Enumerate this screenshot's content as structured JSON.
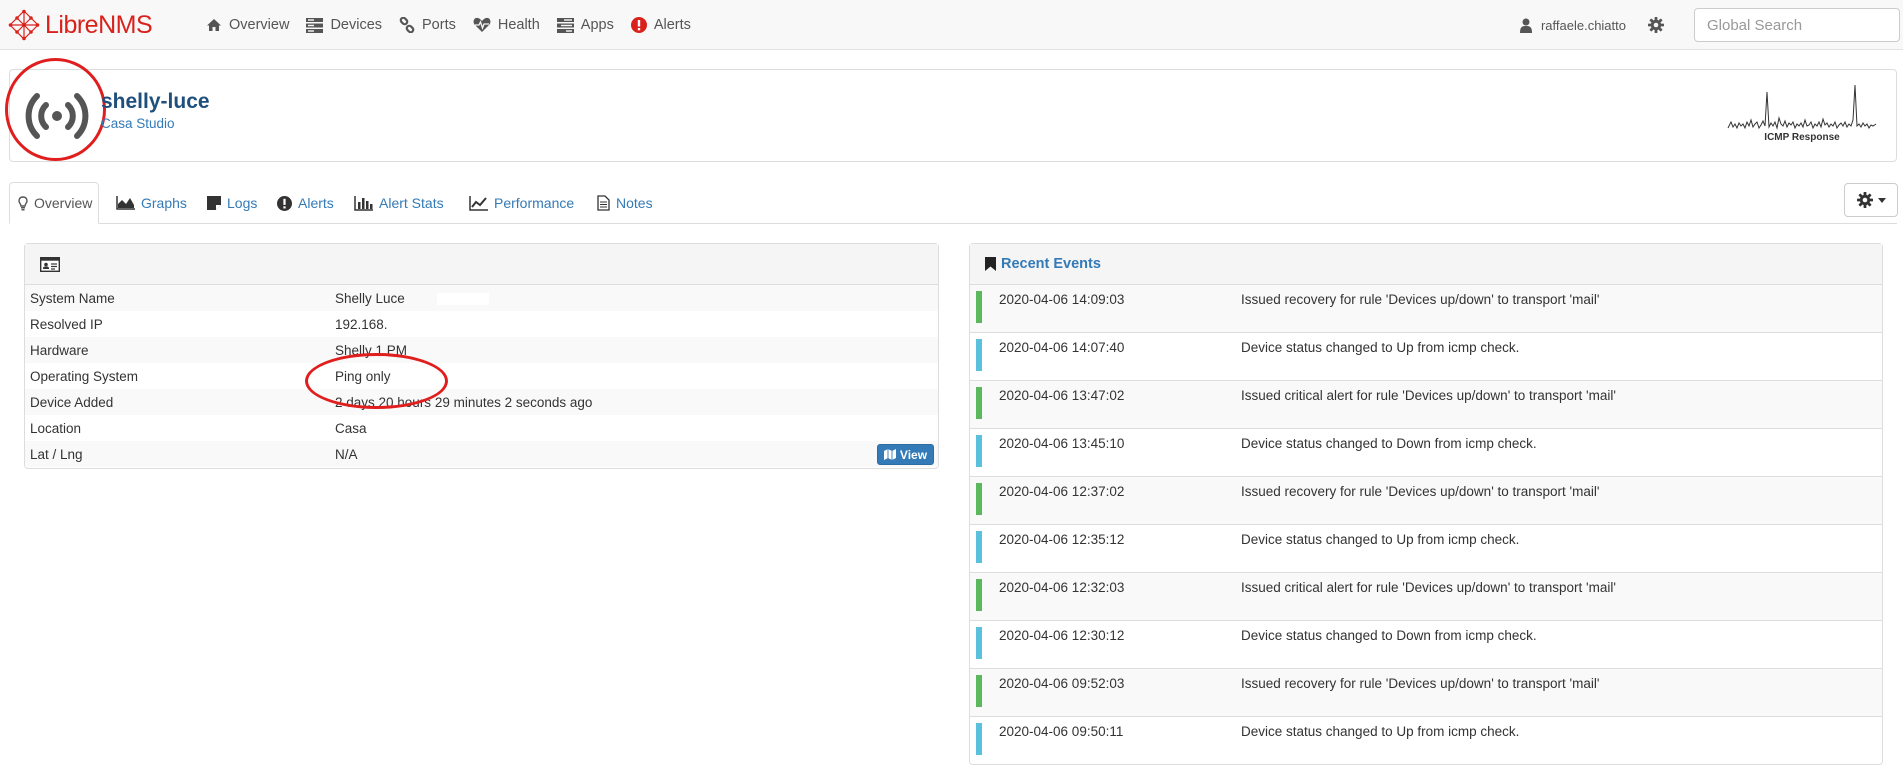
{
  "navbar": {
    "brand_libre": "Libre",
    "brand_nms": "NMS",
    "items": [
      {
        "label": "Overview",
        "icon": "home-icon"
      },
      {
        "label": "Devices",
        "icon": "server-icon"
      },
      {
        "label": "Ports",
        "icon": "link-icon"
      },
      {
        "label": "Health",
        "icon": "heartbeat-icon"
      },
      {
        "label": "Apps",
        "icon": "tasks-icon"
      },
      {
        "label": "Alerts",
        "icon": "exclamation-circle-icon"
      }
    ],
    "user": "raffaele.chiatto",
    "search_placeholder": "Global Search"
  },
  "device": {
    "name": "shelly-luce",
    "location": "Casa Studio",
    "sparkline_label": "ICMP Response"
  },
  "tabs": [
    {
      "label": "Overview",
      "icon": "lightbulb-icon",
      "active": true
    },
    {
      "label": "Graphs",
      "icon": "area-chart-icon"
    },
    {
      "label": "Logs",
      "icon": "sticky-note-icon"
    },
    {
      "label": "Alerts",
      "icon": "exclamation-circle-icon"
    },
    {
      "label": "Alert Stats",
      "icon": "bar-chart-icon"
    },
    {
      "label": "Performance",
      "icon": "line-chart-icon"
    },
    {
      "label": "Notes",
      "icon": "file-text-icon"
    }
  ],
  "overview": {
    "rows": [
      {
        "label": "System Name",
        "value": "Shelly Luce"
      },
      {
        "label": "Resolved IP",
        "value": "192.168."
      },
      {
        "label": "Hardware",
        "value": "Shelly 1 PM"
      },
      {
        "label": "Operating System",
        "value": "Ping only"
      },
      {
        "label": "Device Added",
        "value": "2 days 20 hours 29 minutes 2 seconds ago"
      },
      {
        "label": "Location",
        "value": "Casa"
      },
      {
        "label": "Lat / Lng",
        "value": "N/A"
      }
    ],
    "view_button": "View"
  },
  "events": {
    "title": "Recent Events",
    "colors": {
      "ok": "#5cb85c",
      "info": "#5bc0de"
    },
    "rows": [
      {
        "time": "2020-04-06 14:09:03",
        "message": "Issued recovery for rule 'Devices up/down' to transport 'mail'",
        "type": "ok"
      },
      {
        "time": "2020-04-06 14:07:40",
        "message": "Device status changed to Up from icmp check.",
        "type": "info"
      },
      {
        "time": "2020-04-06 13:47:02",
        "message": "Issued critical alert for rule 'Devices up/down' to transport 'mail'",
        "type": "ok"
      },
      {
        "time": "2020-04-06 13:45:10",
        "message": "Device status changed to Down from icmp check.",
        "type": "info"
      },
      {
        "time": "2020-04-06 12:37:02",
        "message": "Issued recovery for rule 'Devices up/down' to transport 'mail'",
        "type": "ok"
      },
      {
        "time": "2020-04-06 12:35:12",
        "message": "Device status changed to Up from icmp check.",
        "type": "info"
      },
      {
        "time": "2020-04-06 12:32:03",
        "message": "Issued critical alert for rule 'Devices up/down' to transport 'mail'",
        "type": "ok"
      },
      {
        "time": "2020-04-06 12:30:12",
        "message": "Device status changed to Down from icmp check.",
        "type": "info"
      },
      {
        "time": "2020-04-06 09:52:03",
        "message": "Issued recovery for rule 'Devices up/down' to transport 'mail'",
        "type": "ok"
      },
      {
        "time": "2020-04-06 09:50:11",
        "message": "Device status changed to Up from icmp check.",
        "type": "info"
      }
    ]
  }
}
